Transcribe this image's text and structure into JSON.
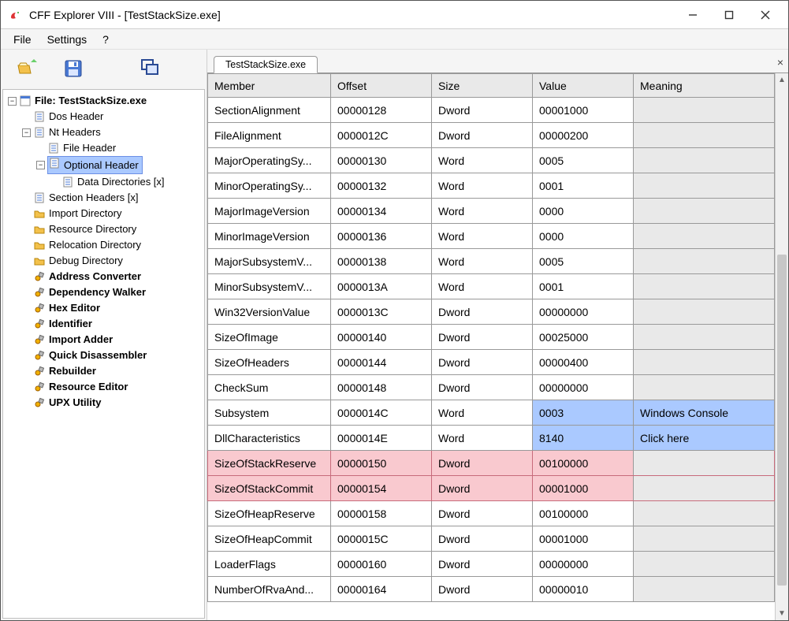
{
  "window": {
    "title": "CFF Explorer VIII - [TestStackSize.exe]"
  },
  "menu": {
    "file": "File",
    "settings": "Settings",
    "help": "?"
  },
  "toolbar_icons": {
    "open": "open-icon",
    "save": "save-icon",
    "windows": "cascade-icon"
  },
  "tree": {
    "root_label": "File: TestStackSize.exe",
    "items": [
      {
        "label": "Dos Header",
        "icon": "page",
        "depth": 2
      },
      {
        "label": "Nt Headers",
        "icon": "page",
        "depth": 2,
        "expander": "-"
      },
      {
        "label": "File Header",
        "icon": "page",
        "depth": 3
      },
      {
        "label": "Optional Header",
        "icon": "page",
        "depth": 3,
        "selected": true,
        "expander": "-"
      },
      {
        "label": "Data Directories [x]",
        "icon": "page",
        "depth": 4
      },
      {
        "label": "Section Headers [x]",
        "icon": "page",
        "depth": 2
      },
      {
        "label": "Import Directory",
        "icon": "folder",
        "depth": 2
      },
      {
        "label": "Resource Directory",
        "icon": "folder",
        "depth": 2
      },
      {
        "label": "Relocation Directory",
        "icon": "folder",
        "depth": 2
      },
      {
        "label": "Debug Directory",
        "icon": "folder",
        "depth": 2
      },
      {
        "label": "Address Converter",
        "icon": "tool",
        "depth": 2,
        "bold": true
      },
      {
        "label": "Dependency Walker",
        "icon": "tool",
        "depth": 2,
        "bold": true
      },
      {
        "label": "Hex Editor",
        "icon": "tool",
        "depth": 2,
        "bold": true
      },
      {
        "label": "Identifier",
        "icon": "tool",
        "depth": 2,
        "bold": true
      },
      {
        "label": "Import Adder",
        "icon": "tool",
        "depth": 2,
        "bold": true
      },
      {
        "label": "Quick Disassembler",
        "icon": "tool",
        "depth": 2,
        "bold": true
      },
      {
        "label": "Rebuilder",
        "icon": "tool",
        "depth": 2,
        "bold": true
      },
      {
        "label": "Resource Editor",
        "icon": "tool",
        "depth": 2,
        "bold": true
      },
      {
        "label": "UPX Utility",
        "icon": "tool",
        "depth": 2,
        "bold": true
      }
    ]
  },
  "tab": {
    "label": "TestStackSize.exe"
  },
  "grid": {
    "headers": {
      "member": "Member",
      "offset": "Offset",
      "size": "Size",
      "value": "Value",
      "meaning": "Meaning"
    },
    "rows": [
      {
        "member": "SectionAlignment",
        "offset": "00000128",
        "size": "Dword",
        "value": "00001000",
        "meaning": ""
      },
      {
        "member": "FileAlignment",
        "offset": "0000012C",
        "size": "Dword",
        "value": "00000200",
        "meaning": ""
      },
      {
        "member": "MajorOperatingSy...",
        "offset": "00000130",
        "size": "Word",
        "value": "0005",
        "meaning": ""
      },
      {
        "member": "MinorOperatingSy...",
        "offset": "00000132",
        "size": "Word",
        "value": "0001",
        "meaning": ""
      },
      {
        "member": "MajorImageVersion",
        "offset": "00000134",
        "size": "Word",
        "value": "0000",
        "meaning": ""
      },
      {
        "member": "MinorImageVersion",
        "offset": "00000136",
        "size": "Word",
        "value": "0000",
        "meaning": ""
      },
      {
        "member": "MajorSubsystemV...",
        "offset": "00000138",
        "size": "Word",
        "value": "0005",
        "meaning": ""
      },
      {
        "member": "MinorSubsystemV...",
        "offset": "0000013A",
        "size": "Word",
        "value": "0001",
        "meaning": ""
      },
      {
        "member": "Win32VersionValue",
        "offset": "0000013C",
        "size": "Dword",
        "value": "00000000",
        "meaning": ""
      },
      {
        "member": "SizeOfImage",
        "offset": "00000140",
        "size": "Dword",
        "value": "00025000",
        "meaning": ""
      },
      {
        "member": "SizeOfHeaders",
        "offset": "00000144",
        "size": "Dword",
        "value": "00000400",
        "meaning": ""
      },
      {
        "member": "CheckSum",
        "offset": "00000148",
        "size": "Dword",
        "value": "00000000",
        "meaning": ""
      },
      {
        "member": "Subsystem",
        "offset": "0000014C",
        "size": "Word",
        "value": "0003",
        "meaning": "Windows Console",
        "hl": "blue"
      },
      {
        "member": "DllCharacteristics",
        "offset": "0000014E",
        "size": "Word",
        "value": "8140",
        "meaning": "Click here",
        "hl": "blue"
      },
      {
        "member": "SizeOfStackReserve",
        "offset": "00000150",
        "size": "Dword",
        "value": "00100000",
        "meaning": "",
        "hl": "pink"
      },
      {
        "member": "SizeOfStackCommit",
        "offset": "00000154",
        "size": "Dword",
        "value": "00001000",
        "meaning": "",
        "hl": "pink"
      },
      {
        "member": "SizeOfHeapReserve",
        "offset": "00000158",
        "size": "Dword",
        "value": "00100000",
        "meaning": ""
      },
      {
        "member": "SizeOfHeapCommit",
        "offset": "0000015C",
        "size": "Dword",
        "value": "00001000",
        "meaning": ""
      },
      {
        "member": "LoaderFlags",
        "offset": "00000160",
        "size": "Dword",
        "value": "00000000",
        "meaning": ""
      },
      {
        "member": "NumberOfRvaAnd...",
        "offset": "00000164",
        "size": "Dword",
        "value": "00000010",
        "meaning": ""
      }
    ]
  }
}
